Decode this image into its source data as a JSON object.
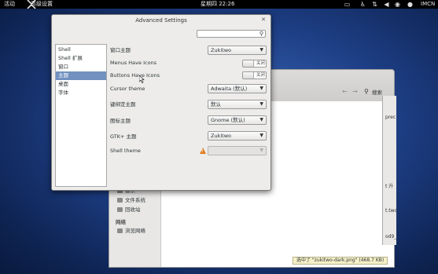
{
  "topbar": {
    "activities": "活动",
    "app_menu": "高级设置",
    "clock": "星期四 22:26",
    "input_method": "IMCN",
    "icons": [
      "display-icon",
      "accessibility-icon",
      "network-icon",
      "volume-icon",
      "chat-icon",
      "user-icon"
    ]
  },
  "file_manager": {
    "search_label": "搜索",
    "sidebar": {
      "partial_item": "音乐",
      "items": [
        "文件系统",
        "回收站"
      ],
      "network_header": "网络",
      "network_items": [
        "浏览网络"
      ]
    },
    "status": "选中了 \"zukitwo-dark.png\" (468.7 KB)"
  },
  "right_window": {
    "fragments": [
      "prec",
      "t 升",
      "t.two",
      "od9_"
    ]
  },
  "dialog": {
    "title": "Advanced Settings",
    "search_placeholder": "",
    "categories": [
      {
        "label": "Shell",
        "selected": false
      },
      {
        "label": "Shell 扩展",
        "selected": false
      },
      {
        "label": "窗口",
        "selected": false
      },
      {
        "label": "主题",
        "selected": true
      },
      {
        "label": "桌面",
        "selected": false
      },
      {
        "label": "字体",
        "selected": false
      }
    ],
    "settings": {
      "window_theme": {
        "label": "窗口主题",
        "value": "Zukitwo"
      },
      "menus_have_icons": {
        "label": "Menus Have Icons",
        "state": "关闭"
      },
      "buttons_have_icons": {
        "label": "Buttons Have Icons",
        "state": "关闭"
      },
      "cursor_theme": {
        "label": "Cursor theme",
        "value": "Adwaita (默认)"
      },
      "keybinding_theme": {
        "label": "键绑定主题",
        "value": "默认"
      },
      "icon_theme": {
        "label": "图标主题",
        "value": "Gnome (默认)"
      },
      "gtk_theme": {
        "label": "GTK+ 主题",
        "value": "Zukitwo"
      },
      "shell_theme": {
        "label": "Shell theme",
        "value": ""
      }
    }
  }
}
